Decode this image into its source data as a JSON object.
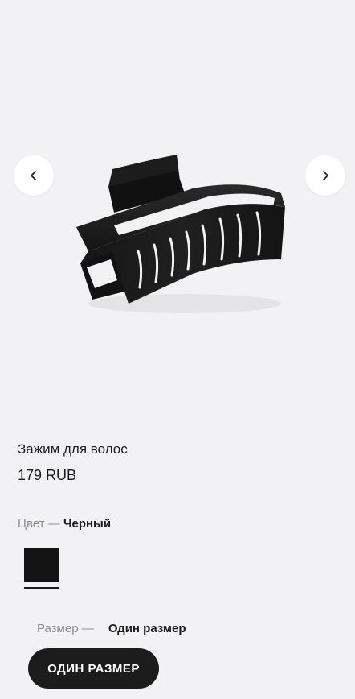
{
  "gallery": {
    "prev_icon": "chevron-left-icon",
    "next_icon": "chevron-right-icon",
    "image": "hair-claw-clip-image"
  },
  "product": {
    "title": "Зажим для волос",
    "price": "179 RUB"
  },
  "color": {
    "label": "Цвет — ",
    "value": "Черный",
    "swatches": [
      {
        "name": "Черный",
        "hex": "#141414",
        "selected": true
      }
    ]
  },
  "size": {
    "label": "Размер — ",
    "value": "Один размер",
    "options": [
      {
        "label": "ОДИН РАЗМЕР",
        "selected": true
      }
    ]
  },
  "colors": {
    "background": "#f2f2f4",
    "chip_bg": "#1c1c1c",
    "muted_text": "#8c8c8c"
  }
}
